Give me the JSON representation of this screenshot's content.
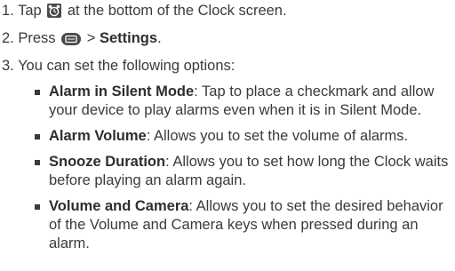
{
  "steps": [
    {
      "number": "1.",
      "before": "Tap",
      "icon": "alarm-clock-icon",
      "after": "at the bottom of the Clock screen."
    },
    {
      "number": "2.",
      "before": "Press",
      "icon": "menu-key-icon",
      "sep": ">",
      "bold": "Settings",
      "after": "."
    },
    {
      "number": "3.",
      "text": "You can set the following options:"
    }
  ],
  "options": [
    {
      "title": "Alarm in Silent Mode",
      "description": ": Tap to place a checkmark and allow your device to play alarms even when it is in Silent Mode."
    },
    {
      "title": "Alarm Volume",
      "description": ": Allows you to set the volume of alarms."
    },
    {
      "title": "Snooze Duration",
      "description": ": Allows you to set how long the Clock waits before playing an alarm again."
    },
    {
      "title": "Volume and Camera",
      "description": ": Allows you to set the desired behavior of the Volume and Camera keys when pressed during an alarm."
    }
  ],
  "colors": {
    "text": "#3a3a3a",
    "icon_bg": "#4a4a4a"
  }
}
